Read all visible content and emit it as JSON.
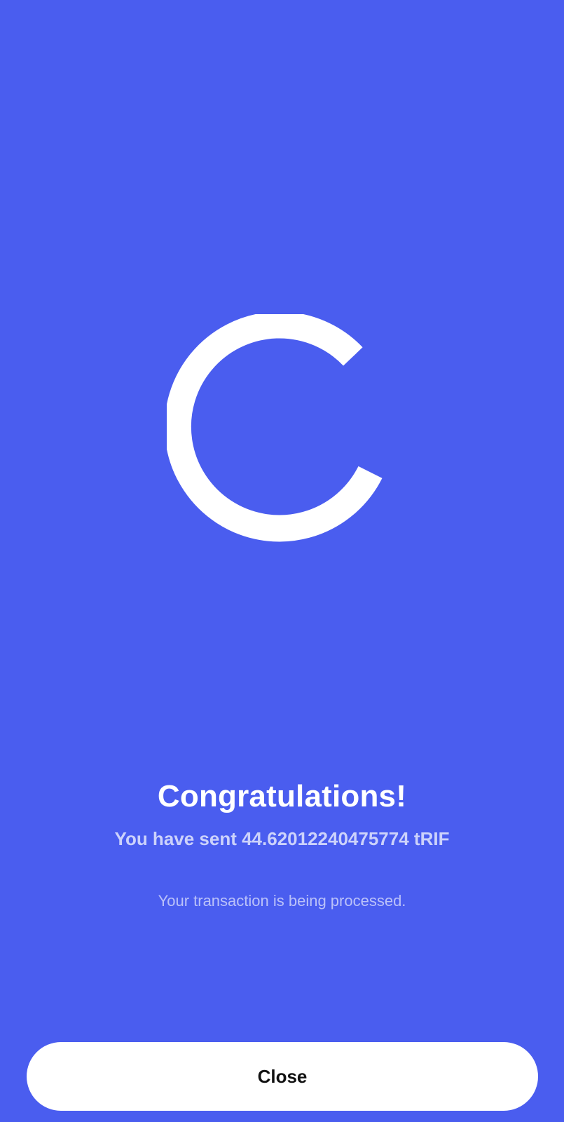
{
  "colors": {
    "background": "#4A5DEF",
    "logo": "#FFFFFF",
    "button_bg": "#FFFFFF",
    "button_text": "#111111"
  },
  "logo": {
    "icon": "c-ring-loading-icon"
  },
  "main": {
    "title": "Congratulations!",
    "subtitle": "You have sent 44.62012240475774 tRIF",
    "status": "Your transaction is being processed."
  },
  "footer": {
    "close_label": "Close"
  }
}
